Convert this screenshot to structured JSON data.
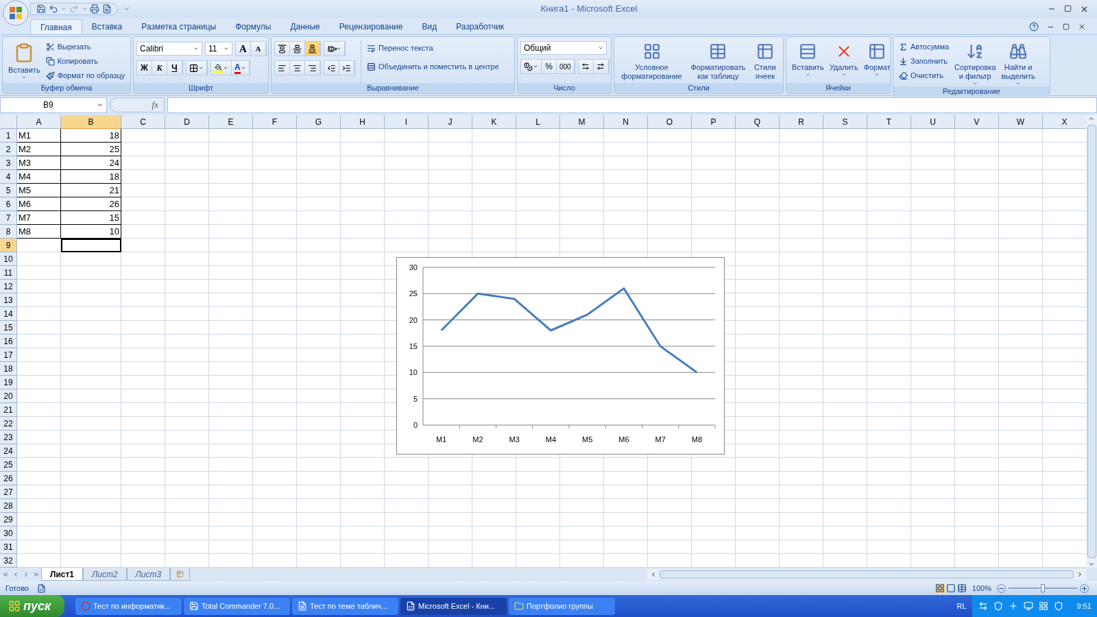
{
  "window": {
    "title": "Книга1 - Microsoft Excel"
  },
  "ribbon_tabs": [
    {
      "label": "Главная",
      "selected": true
    },
    {
      "label": "Вставка",
      "selected": false
    },
    {
      "label": "Разметка страницы",
      "selected": false
    },
    {
      "label": "Формулы",
      "selected": false
    },
    {
      "label": "Данные",
      "selected": false
    },
    {
      "label": "Рецензирование",
      "selected": false
    },
    {
      "label": "Вид",
      "selected": false
    },
    {
      "label": "Разработчик",
      "selected": false
    }
  ],
  "clipboard": {
    "title": "Буфер обмена",
    "paste": "Вставить",
    "items": [
      "Вырезать",
      "Копировать",
      "Формат по образцу"
    ]
  },
  "font": {
    "title": "Шрифт",
    "family": "Calibri",
    "size": "11",
    "grow": "A",
    "shrink": "A",
    "styles": [
      "Ж",
      "К",
      "Ч"
    ],
    "color_glyph": "A"
  },
  "alignment": {
    "title": "Выравнивание",
    "vertical": [
      {
        "kind": "top",
        "selected": false
      },
      {
        "kind": "middle",
        "selected": false
      },
      {
        "kind": "bottom",
        "selected": true
      }
    ],
    "wrap": "Перенос текста",
    "merge": "Объединить и поместить в центре"
  },
  "number": {
    "title": "Число",
    "format": "Общий",
    "percent": "%",
    "thousands": "000"
  },
  "styles": {
    "title": "Стили",
    "buttons": [
      {
        "lines": [
          "Условное",
          "форматирование"
        ]
      },
      {
        "lines": [
          "Форматировать",
          "как таблицу"
        ]
      },
      {
        "lines": [
          "Стили",
          "ячеек"
        ]
      }
    ]
  },
  "cells_group": {
    "title": "Ячейки",
    "buttons": [
      "Вставить",
      "Удалить",
      "Формат"
    ]
  },
  "editing": {
    "title": "Редактирование",
    "small": [
      "Автосумма",
      "Заполнить",
      "Очистить"
    ],
    "buttons": [
      {
        "lines": [
          "Сортировка",
          "и фильтр"
        ]
      },
      {
        "lines": [
          "Найти и",
          "выделить"
        ]
      }
    ]
  },
  "formula_bar": {
    "name_box": "B9",
    "fx": "fx"
  },
  "sheet": {
    "columns": [
      {
        "label": "A",
        "selected": false
      },
      {
        "label": "B",
        "selected": true
      },
      {
        "label": "C",
        "selected": false
      },
      {
        "label": "D",
        "selected": false
      },
      {
        "label": "E",
        "selected": false
      },
      {
        "label": "F",
        "selected": false
      },
      {
        "label": "G",
        "selected": false
      },
      {
        "label": "H",
        "selected": false
      },
      {
        "label": "I",
        "selected": false
      },
      {
        "label": "J",
        "selected": false
      },
      {
        "label": "K",
        "selected": false
      },
      {
        "label": "L",
        "selected": false
      },
      {
        "label": "M",
        "selected": false
      },
      {
        "label": "N",
        "selected": false
      },
      {
        "label": "O",
        "selected": false
      },
      {
        "label": "P",
        "selected": false
      },
      {
        "label": "Q",
        "selected": false
      },
      {
        "label": "R",
        "selected": false
      },
      {
        "label": "S",
        "selected": false
      },
      {
        "label": "T",
        "selected": false
      },
      {
        "label": "U",
        "selected": false
      },
      {
        "label": "V",
        "selected": false
      },
      {
        "label": "W",
        "selected": false
      },
      {
        "label": "X",
        "selected": false
      }
    ],
    "rows": [
      {
        "label": "1",
        "selected": false
      },
      {
        "label": "2",
        "selected": false
      },
      {
        "label": "3",
        "selected": false
      },
      {
        "label": "4",
        "selected": false
      },
      {
        "label": "5",
        "selected": false
      },
      {
        "label": "6",
        "selected": false
      },
      {
        "label": "7",
        "selected": false
      },
      {
        "label": "8",
        "selected": false
      },
      {
        "label": "9",
        "selected": true
      },
      {
        "label": "10",
        "selected": false
      },
      {
        "label": "11",
        "selected": false
      },
      {
        "label": "12",
        "selected": false
      },
      {
        "label": "13",
        "selected": false
      },
      {
        "label": "14",
        "selected": false
      },
      {
        "label": "15",
        "selected": false
      },
      {
        "label": "16",
        "selected": false
      },
      {
        "label": "17",
        "selected": false
      },
      {
        "label": "18",
        "selected": false
      },
      {
        "label": "19",
        "selected": false
      },
      {
        "label": "20",
        "selected": false
      },
      {
        "label": "21",
        "selected": false
      },
      {
        "label": "22",
        "selected": false
      },
      {
        "label": "23",
        "selected": false
      },
      {
        "label": "24",
        "selected": false
      },
      {
        "label": "25",
        "selected": false
      },
      {
        "label": "26",
        "selected": false
      },
      {
        "label": "27",
        "selected": false
      },
      {
        "label": "28",
        "selected": false
      },
      {
        "label": "29",
        "selected": false
      },
      {
        "label": "30",
        "selected": false
      },
      {
        "label": "31",
        "selected": false
      },
      {
        "label": "32",
        "selected": false
      }
    ],
    "data": [
      [
        "M1",
        "18"
      ],
      [
        "M2",
        "25"
      ],
      [
        "M3",
        "24"
      ],
      [
        "M4",
        "18"
      ],
      [
        "M5",
        "21"
      ],
      [
        "M6",
        "26"
      ],
      [
        "M7",
        "15"
      ],
      [
        "M8",
        "10"
      ]
    ],
    "chart": {
      "chart_data": {
        "type": "line",
        "categories": [
          "M1",
          "M2",
          "M3",
          "M4",
          "M5",
          "M6",
          "M7",
          "M8"
        ],
        "series": [
          {
            "color": "#4a7ebb",
            "values": [
              18,
              25,
              24,
              18,
              21,
              26,
              15,
              10
            ]
          }
        ],
        "grid": true,
        "ylim": [
          0,
          30
        ],
        "yticks": [
          0,
          5,
          10,
          15,
          20,
          25,
          30
        ]
      }
    }
  },
  "sheet_tabs": [
    {
      "label": "Лист1",
      "selected": true
    },
    {
      "label": "Лист2",
      "selected": false
    },
    {
      "label": "Лист3",
      "selected": false
    }
  ],
  "status_bar": {
    "text": "Готово",
    "zoom": "100%",
    "zoom_slider": {
      "level": 0.5
    }
  },
  "taskbar": {
    "start": "пуск",
    "items": [
      {
        "label": "Тест по информатик...",
        "kind": "browser",
        "selected": false
      },
      {
        "label": "Total Commander 7.0...",
        "kind": "disk",
        "selected": false
      },
      {
        "label": "Тест по теме таблич...",
        "kind": "document",
        "selected": false
      },
      {
        "label": "Microsoft Excel - Кни...",
        "kind": "spreadsheet",
        "selected": true
      },
      {
        "label": "Портфолио группы",
        "kind": "folder",
        "selected": false
      }
    ],
    "lang": "RL",
    "clock": "9:51"
  }
}
